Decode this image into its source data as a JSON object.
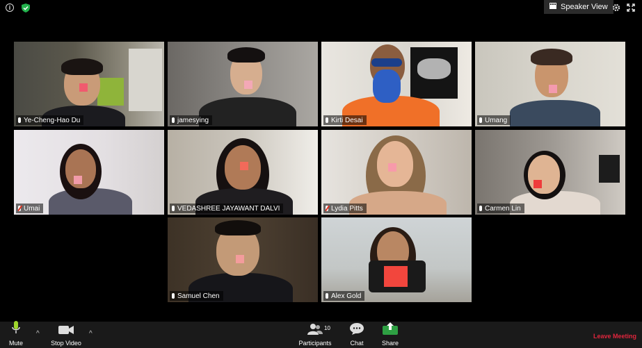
{
  "top_bar": {
    "view_button_label": "Speaker View",
    "icons": [
      "info-icon",
      "shield-icon",
      "speaker-view-icon",
      "gear-icon",
      "fullscreen-icon"
    ]
  },
  "participants": [
    {
      "name": "Ye-Cheng-Hao Du",
      "muted": false,
      "active_speaker": true
    },
    {
      "name": "jamesying",
      "muted": false,
      "active_speaker": false
    },
    {
      "name": "Kirti Desai",
      "muted": false,
      "active_speaker": false
    },
    {
      "name": "Umang",
      "muted": false,
      "active_speaker": false
    },
    {
      "name": "Umai",
      "muted": true,
      "active_speaker": false
    },
    {
      "name": "VEDASHREE JAYAWANT DALVI",
      "muted": false,
      "active_speaker": false
    },
    {
      "name": "Lydia Pitts",
      "muted": true,
      "active_speaker": false
    },
    {
      "name": "Carmen Lin",
      "muted": false,
      "active_speaker": false
    },
    {
      "name": "Samuel Chen",
      "muted": false,
      "active_speaker": false
    },
    {
      "name": "Alex Gold",
      "muted": false,
      "active_speaker": false
    }
  ],
  "toolbar": {
    "mute_label": "Mute",
    "stop_video_label": "Stop Video",
    "participants_label": "Participants",
    "participants_count": "10",
    "chat_label": "Chat",
    "share_label": "Share",
    "leave_label": "Leave Meeting"
  },
  "colors": {
    "active_speaker_border": "#c5e026",
    "share_green": "#2ea043",
    "leave_red": "#e0263d",
    "sticky_note": "#f05a6e"
  }
}
